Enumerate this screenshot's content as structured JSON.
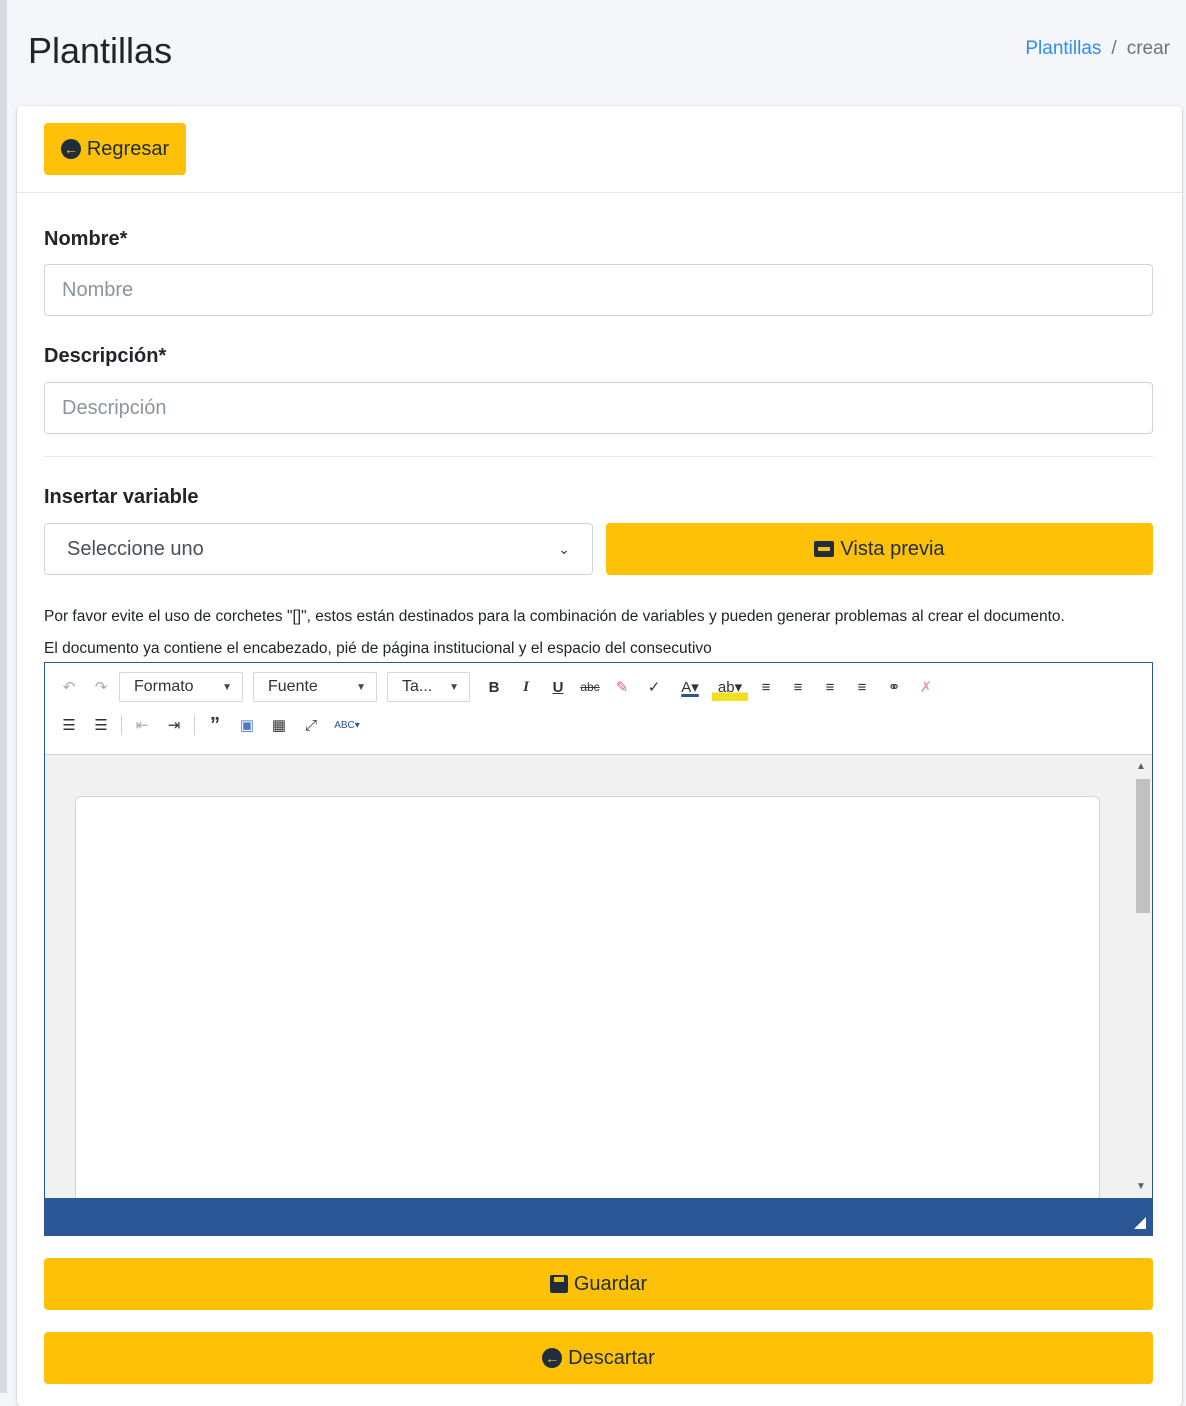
{
  "header": {
    "title": "Plantillas",
    "breadcrumb": {
      "link": "Plantillas",
      "separator": "/",
      "current": "crear"
    }
  },
  "actions": {
    "back_label": "Regresar"
  },
  "form": {
    "nombre": {
      "label": "Nombre*",
      "placeholder": "Nombre"
    },
    "descripcion": {
      "label": "Descripción*",
      "placeholder": "Descripción"
    },
    "variable": {
      "label": "Insertar variable",
      "selected": "Seleccione uno"
    },
    "preview_label": "Vista previa",
    "notes": [
      "Por favor evite el uso de corchetes \"[]\", estos están destinados para la combinación de variables y pueden generar problemas al crear el documento.",
      "El documento ya contiene el encabezado, pié de página institucional y el espacio del consecutivo"
    ]
  },
  "editor": {
    "combos": {
      "format": "Formato",
      "font": "Fuente",
      "size": "Ta..."
    },
    "spellcheck_label": "ABC"
  },
  "footer_actions": {
    "save_label": "Guardar",
    "discard_label": "Descartar"
  },
  "colors": {
    "accent": "#ffc107",
    "editor_bar": "#2b5797",
    "link": "#2d8df4"
  }
}
